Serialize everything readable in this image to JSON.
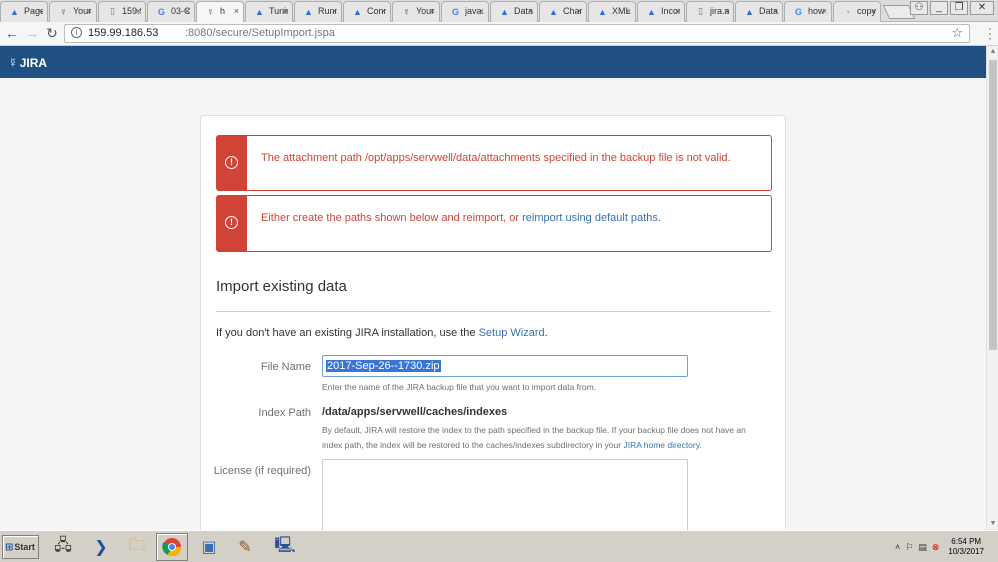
{
  "browser": {
    "tabs": [
      {
        "title": "Page",
        "icon": "atlassian-icon"
      },
      {
        "title": "Your",
        "icon": "jira-icon"
      },
      {
        "title": "159.9",
        "icon": "doc-icon"
      },
      {
        "title": "03-C",
        "icon": "google-icon"
      },
      {
        "title": "h",
        "icon": "jira-icon",
        "active": true
      },
      {
        "title": "Tunin",
        "icon": "atlassian-icon"
      },
      {
        "title": "Runn",
        "icon": "atlassian-icon"
      },
      {
        "title": "Conn",
        "icon": "atlassian-icon"
      },
      {
        "title": "Your",
        "icon": "jira-icon"
      },
      {
        "title": "java.",
        "icon": "google-icon"
      },
      {
        "title": "Datal",
        "icon": "atlassian-icon"
      },
      {
        "title": "Chan",
        "icon": "atlassian-icon"
      },
      {
        "title": "XML E",
        "icon": "atlassian-icon"
      },
      {
        "title": "Incor",
        "icon": "atlassian-icon"
      },
      {
        "title": "jira.a",
        "icon": "doc-icon"
      },
      {
        "title": "Datal",
        "icon": "atlassian-icon"
      },
      {
        "title": "how t",
        "icon": "google-icon"
      },
      {
        "title": "copy",
        "icon": "copy-icon"
      }
    ],
    "url_host": "159.99.186.53",
    "url_rest": ":8080/secure/SetupImport.jspa"
  },
  "header": {
    "product": "JIRA"
  },
  "alerts": [
    {
      "text": "The attachment path /opt/apps/servwell/data/attachments specified in the backup file is not valid."
    },
    {
      "text_prefix": "Either create the paths shown below and reimport, or ",
      "link": "reimport using default paths",
      "text_suffix": "."
    }
  ],
  "import": {
    "title": "Import existing data",
    "intro_prefix": "If you don't have an existing JIRA installation, use the ",
    "intro_link": "Setup Wizard",
    "intro_suffix": ".",
    "file_name_label": "File Name",
    "file_name_value": "2017-Sep-26--1730.zip",
    "file_name_hint": "Enter the name of the JIRA backup file that you want to import data from.",
    "index_path_label": "Index Path",
    "index_path_value": "/data/apps/servwell/caches/indexes",
    "index_hint_line1": "By default, JIRA will restore the index to the path specified in the backup file. If your backup file does not have an",
    "index_hint_line2_prefix": "index path, the index will be restored to the caches/indexes subdirectory in your ",
    "index_hint_link": "JIRA home directory",
    "index_hint_suffix": ".",
    "license_label": "License (if required)"
  },
  "taskbar": {
    "start_label": "Start",
    "time": "6:54 PM",
    "date": "10/3/2017"
  },
  "colors": {
    "jira_header": "#205081",
    "error": "#d04437",
    "link": "#3572b0",
    "selection": "#3875d7"
  }
}
